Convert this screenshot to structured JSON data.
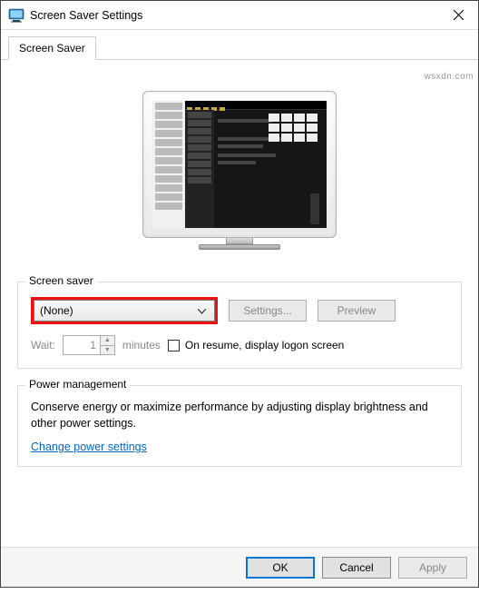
{
  "title": "Screen Saver Settings",
  "tab_label": "Screen Saver",
  "group_ss": {
    "title": "Screen saver",
    "selected": "(None)",
    "settings_btn": "Settings...",
    "preview_btn": "Preview",
    "wait_label": "Wait:",
    "wait_value": "1",
    "wait_unit": "minutes",
    "resume_label": "On resume, display logon screen"
  },
  "group_pm": {
    "title": "Power management",
    "text": "Conserve energy or maximize performance by adjusting display brightness and other power settings.",
    "link": "Change power settings"
  },
  "footer": {
    "ok": "OK",
    "cancel": "Cancel",
    "apply": "Apply"
  },
  "watermark": "wsxdn.com"
}
